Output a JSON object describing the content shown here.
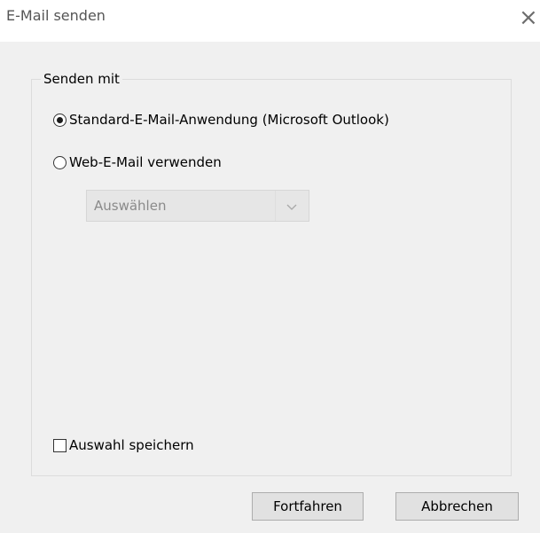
{
  "window": {
    "title": "E-Mail senden",
    "close_glyph": "×"
  },
  "group": {
    "legend": "Senden mit"
  },
  "options": {
    "default_app": {
      "label": "Standard-E-Mail-Anwendung (Microsoft Outlook)",
      "checked": true
    },
    "web_mail": {
      "label": "Web-E-Mail verwenden",
      "checked": false
    }
  },
  "webmail_select": {
    "value": "Auswählen",
    "disabled": true,
    "icon": "chevron-down-icon"
  },
  "save_choice": {
    "label": "Auswahl speichern",
    "checked": false
  },
  "buttons": {
    "continue": "Fortfahren",
    "cancel": "Abbrechen"
  },
  "colors": {
    "title_text": "#555555",
    "client_background": "#f0f0f0",
    "disabled_text": "#8a8a8a",
    "button_background": "#e1e1e1",
    "button_border": "#adadad"
  }
}
